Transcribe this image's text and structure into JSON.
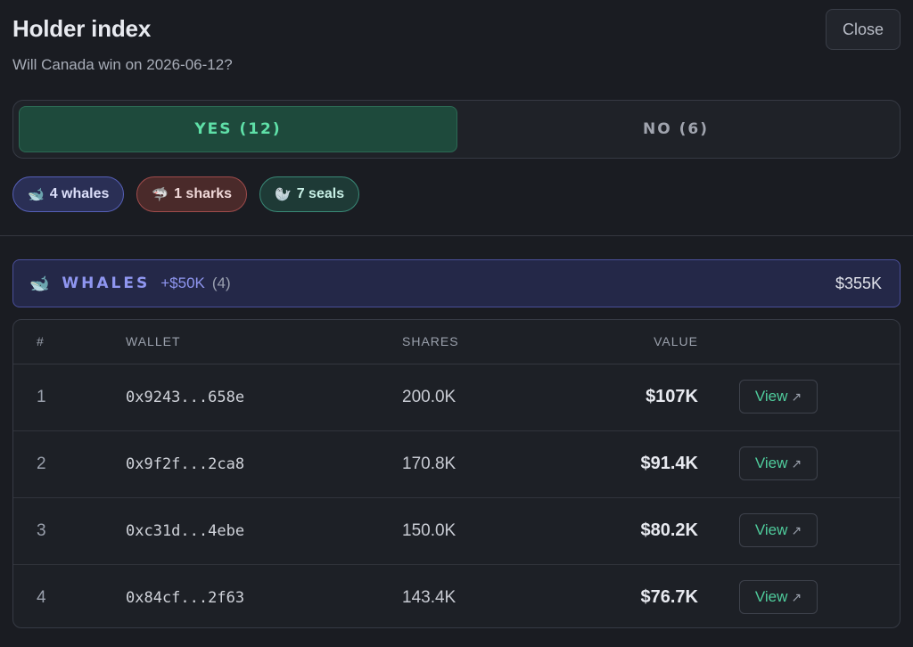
{
  "header": {
    "title": "Holder index",
    "subtitle": "Will Canada win on 2026-06-12?",
    "close_label": "Close"
  },
  "toggle": {
    "yes_label": "YES (12)",
    "no_label": "NO (6)",
    "selected": "yes"
  },
  "chips": {
    "whales": {
      "icon": "🐋",
      "label": "4 whales"
    },
    "sharks": {
      "icon": "🦈",
      "label": "1 sharks"
    },
    "seals": {
      "icon": "🦭",
      "label": "7 seals"
    }
  },
  "section": {
    "icon": "🐋",
    "name": "WHALES",
    "range": "+$50K",
    "count": "(4)",
    "total": "$355K"
  },
  "table": {
    "headers": {
      "index": "#",
      "wallet": "WALLET",
      "shares": "SHARES",
      "value": "VALUE"
    },
    "rows": [
      {
        "index": "1",
        "wallet": "0x9243...658e",
        "shares": "200.0K",
        "value": "$107K",
        "action": "View"
      },
      {
        "index": "2",
        "wallet": "0x9f2f...2ca8",
        "shares": "170.8K",
        "value": "$91.4K",
        "action": "View"
      },
      {
        "index": "3",
        "wallet": "0xc31d...4ebe",
        "shares": "150.0K",
        "value": "$80.2K",
        "action": "View"
      },
      {
        "index": "4",
        "wallet": "0x84cf...2f63",
        "shares": "143.4K",
        "value": "$76.7K",
        "action": "View"
      }
    ]
  },
  "colors": {
    "background": "#1a1c22",
    "accent_green": "#5fe0a8",
    "whale_accent": "#8f96f0"
  }
}
